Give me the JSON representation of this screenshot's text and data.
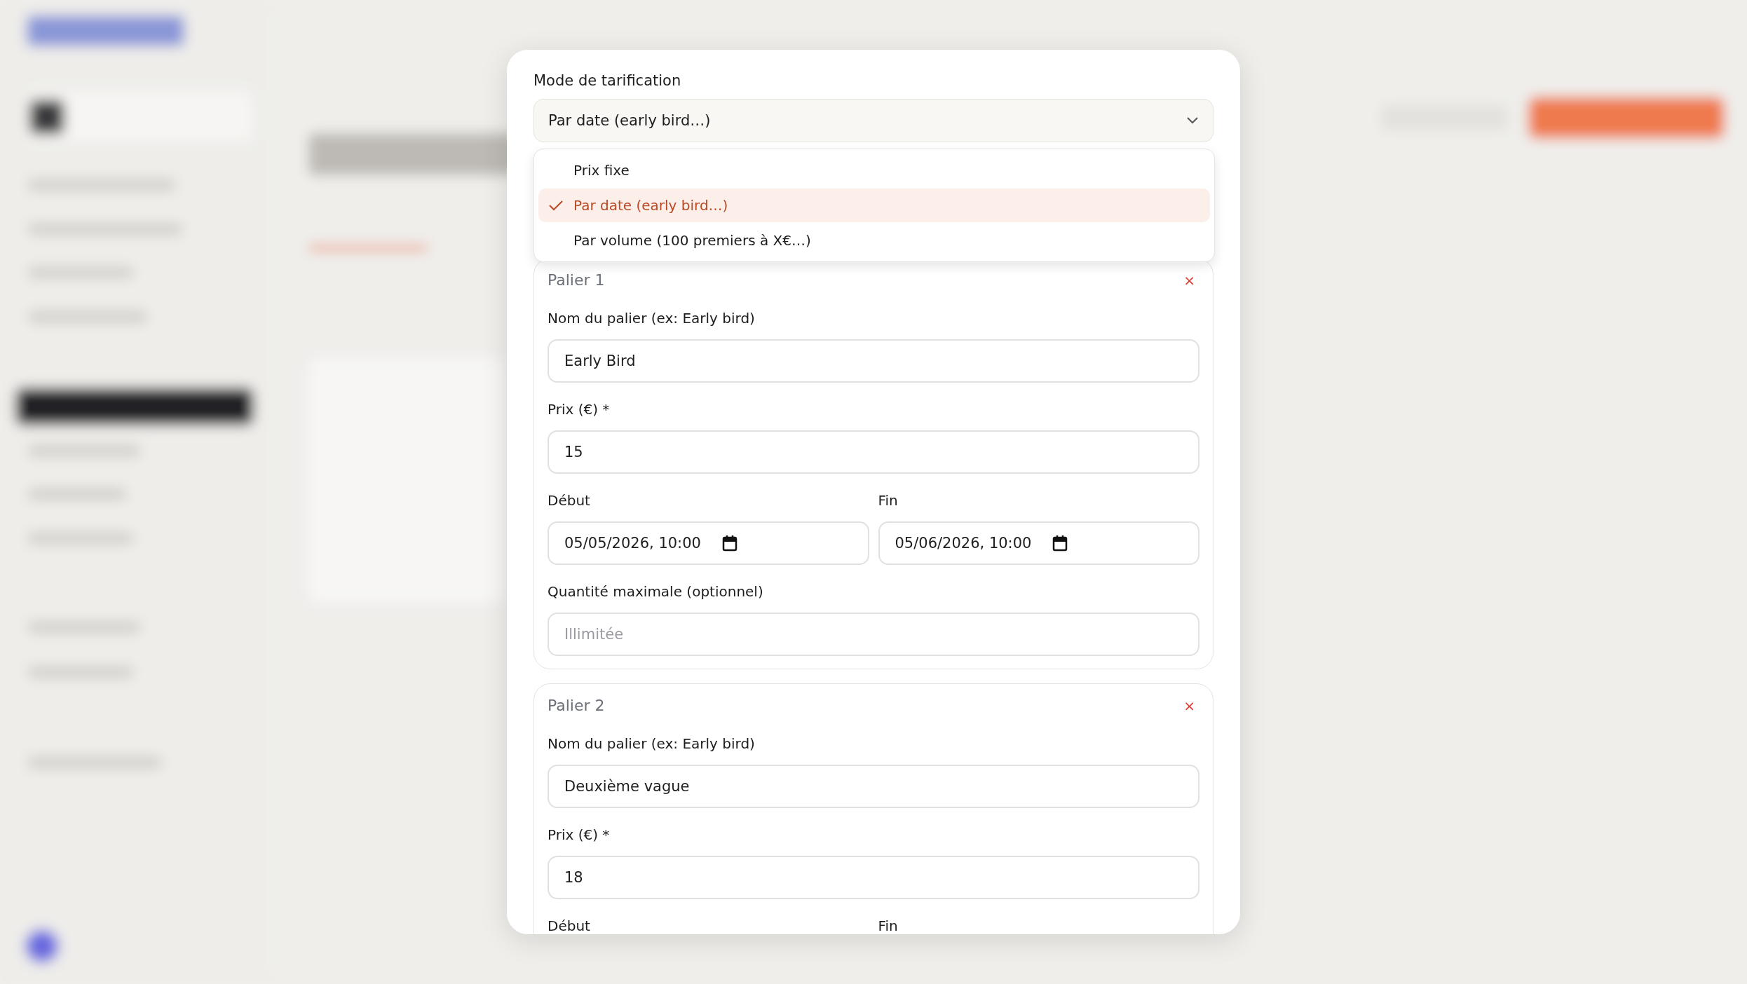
{
  "pricing_mode": {
    "label": "Mode de tarification",
    "value": "Par date (early bird…)",
    "expanded": true,
    "options": [
      {
        "label": "Prix fixe",
        "selected": false
      },
      {
        "label": "Par date (early bird…)",
        "selected": true
      },
      {
        "label": "Par volume (100 premiers à X€…)",
        "selected": false
      }
    ]
  },
  "tiers": [
    {
      "title": "Palier 1",
      "remove": "×",
      "fields": [
        {
          "kind": "text",
          "label": "Nom du palier (ex: Early bird)",
          "value": "Early Bird"
        },
        {
          "kind": "text",
          "label": "Prix (€) *",
          "value": "15"
        },
        {
          "kind": "dates",
          "items": [
            {
              "label": "Début",
              "value": "05/05/2026, 10:00"
            },
            {
              "label": "Fin",
              "value": "05/06/2026, 10:00"
            }
          ]
        },
        {
          "kind": "text",
          "label": "Quantité maximale (optionnel)",
          "placeholder": "Illimitée"
        }
      ]
    },
    {
      "title": "Palier 2",
      "remove": "×",
      "fields": [
        {
          "kind": "text",
          "label": "Nom du palier (ex: Early bird)",
          "value": "Deuxième vague"
        },
        {
          "kind": "text",
          "label": "Prix (€) *",
          "value": "18"
        },
        {
          "kind": "dates",
          "items": [
            {
              "label": "Début"
            },
            {
              "label": "Fin"
            }
          ]
        }
      ]
    }
  ]
}
